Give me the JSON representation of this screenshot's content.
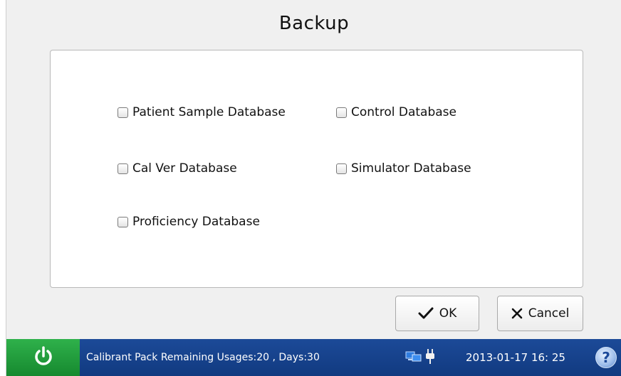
{
  "dialog": {
    "title": "Backup",
    "options": [
      {
        "label": "Patient Sample Database",
        "checked": false
      },
      {
        "label": "Control Database",
        "checked": false
      },
      {
        "label": "Cal Ver Database",
        "checked": false
      },
      {
        "label": "Simulator Database",
        "checked": false
      },
      {
        "label": "Proficiency Database",
        "checked": false
      }
    ],
    "ok_label": "OK",
    "cancel_label": "Cancel"
  },
  "statusbar": {
    "message": "Calibrant Pack Remaining Usages:20 , Days:30",
    "datetime": "2013-01-17  16: 25",
    "help_label": "?",
    "icons": [
      "power-icon",
      "network-icon",
      "power-plug-icon",
      "help-icon"
    ]
  },
  "colors": {
    "statusbar_bg": "#1c4a98",
    "power_button_bg": "#2fb14b",
    "background": "#f0f0f0"
  }
}
